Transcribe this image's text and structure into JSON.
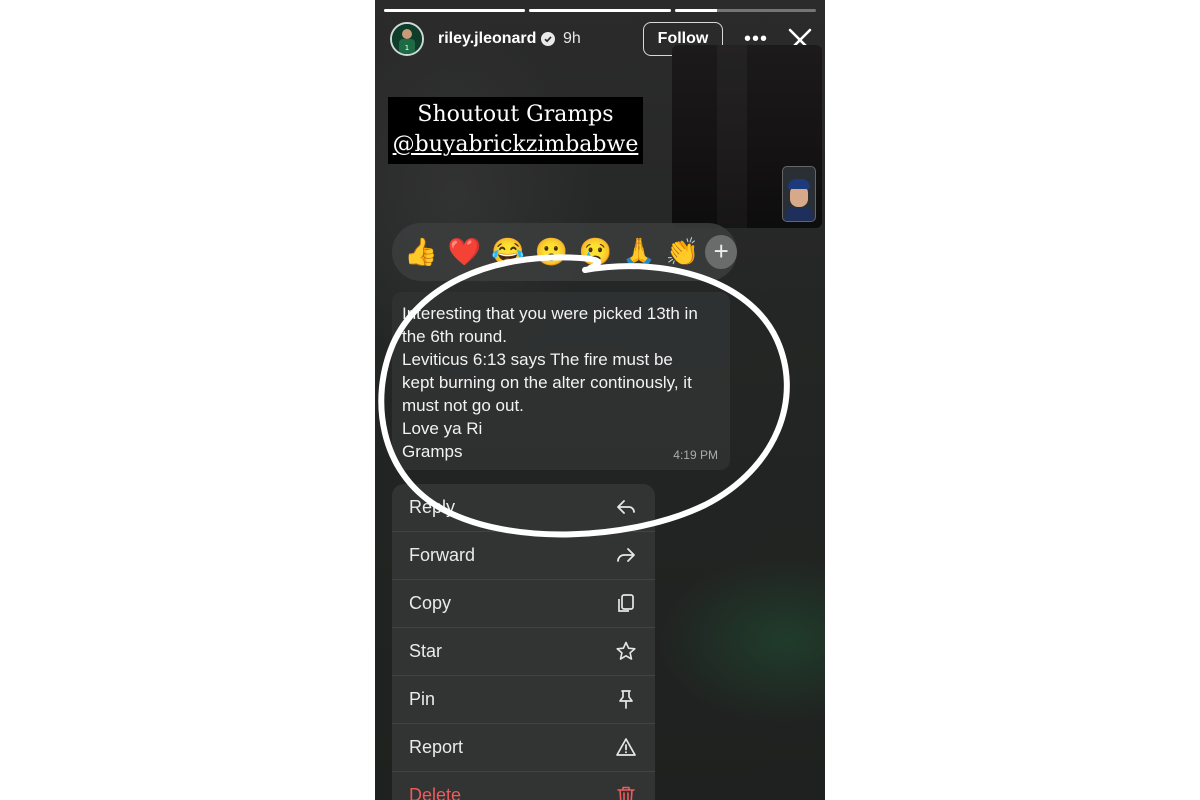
{
  "story": {
    "progress": [
      1.0,
      1.0,
      0.3
    ],
    "username": "riley.jleonard",
    "time_ago": "9h",
    "follow_label": "Follow",
    "more_label": "•••",
    "caption": {
      "line1": "Shoutout Gramps",
      "line2": "@buyabrickzimbabwe"
    }
  },
  "reactions": [
    "👍",
    "❤️",
    "😂",
    "😮",
    "😢",
    "🙏",
    "👏"
  ],
  "reaction_more": "+",
  "message": {
    "lines": [
      "Interesting that you were picked 13th in",
      "the 6th round.",
      "Leviticus 6:13 says The fire must be",
      "kept burning on the alter continously, it",
      "must not go out.",
      "Love ya Ri",
      "Gramps"
    ],
    "time": "4:19 PM"
  },
  "menu": [
    {
      "label": "Reply",
      "icon": "reply-icon"
    },
    {
      "label": "Forward",
      "icon": "forward-icon"
    },
    {
      "label": "Copy",
      "icon": "copy-icon"
    },
    {
      "label": "Star",
      "icon": "star-icon"
    },
    {
      "label": "Pin",
      "icon": "pin-icon"
    },
    {
      "label": "Report",
      "icon": "warning-icon"
    },
    {
      "label": "Delete",
      "icon": "trash-icon",
      "color": "#ef5b5b"
    }
  ]
}
